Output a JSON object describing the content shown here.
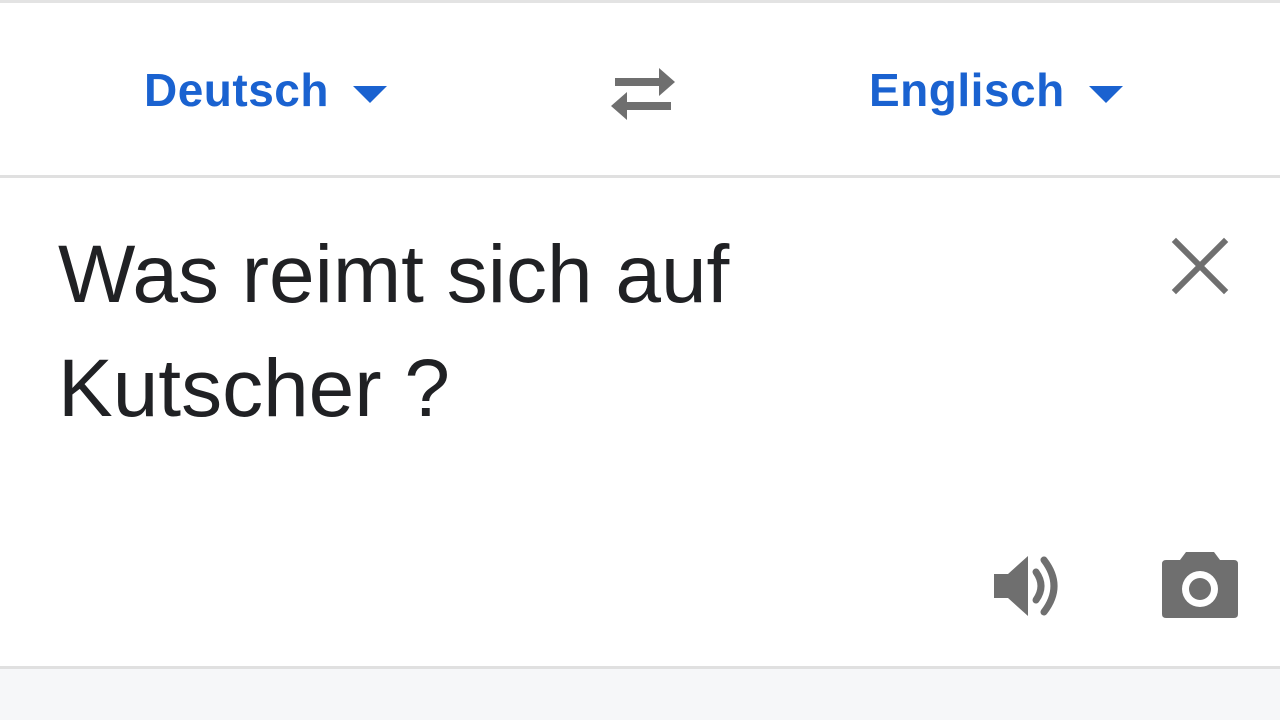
{
  "language_bar": {
    "source_language": "Deutsch",
    "target_language": "Englisch",
    "accent_color": "#1a62d0",
    "swap_icon": "swap-arrows-icon",
    "dropdown_icon": "caret-down-icon"
  },
  "input": {
    "text": "Was reimt sich auf\nKutscher ?",
    "clear_icon": "close-icon"
  },
  "actions": {
    "speaker_icon": "speaker-icon",
    "camera_icon": "camera-icon",
    "icon_color": "#6f6f6f"
  }
}
